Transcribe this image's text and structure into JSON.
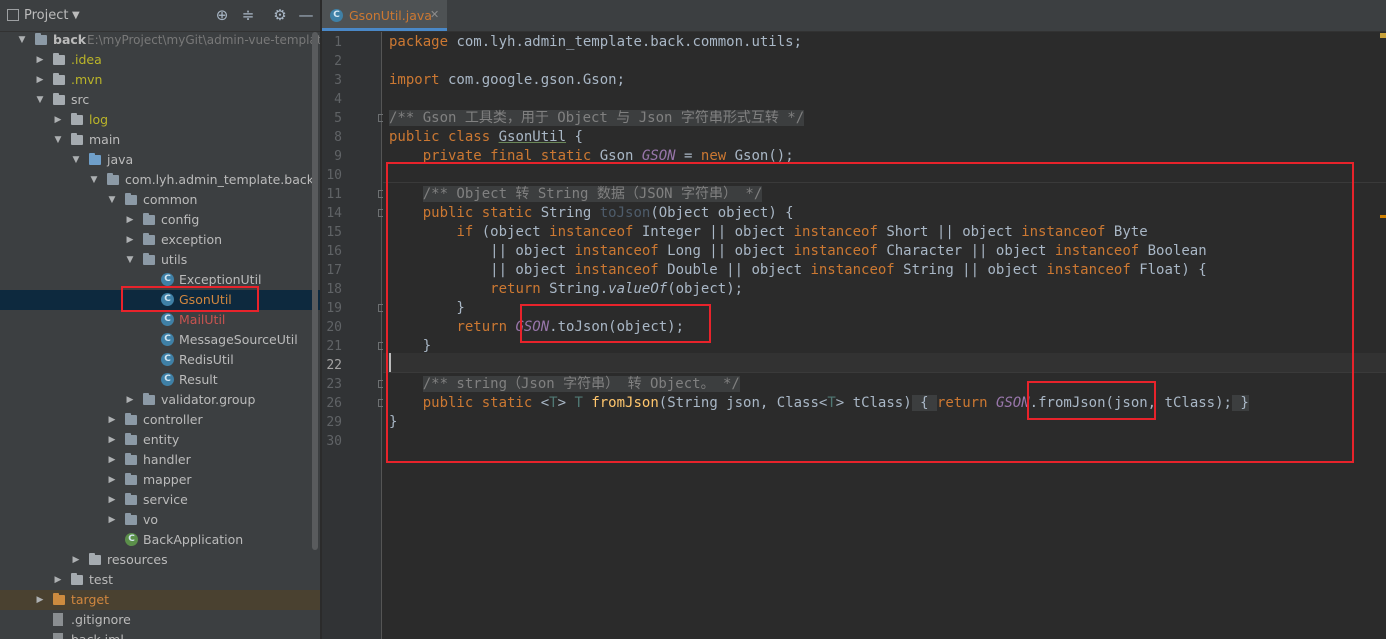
{
  "sidebar": {
    "title": "Project",
    "tree": [
      {
        "label": "back",
        "path": "E:\\myProject\\myGit\\admin-vue-template\\ba",
        "depth": 0,
        "expanded": true,
        "icon": "module-folder-icon",
        "style": "bold"
      },
      {
        "label": ".idea",
        "depth": 1,
        "expanded": false,
        "icon": "folder-icon",
        "style": "yellow"
      },
      {
        "label": ".mvn",
        "depth": 1,
        "expanded": false,
        "icon": "folder-icon",
        "style": "yellow"
      },
      {
        "label": "src",
        "depth": 1,
        "expanded": true,
        "icon": "folder-icon"
      },
      {
        "label": "log",
        "depth": 2,
        "expanded": false,
        "icon": "folder-icon",
        "style": "yellow"
      },
      {
        "label": "main",
        "depth": 2,
        "expanded": true,
        "icon": "folder-icon"
      },
      {
        "label": "java",
        "depth": 3,
        "expanded": true,
        "icon": "source-folder-icon"
      },
      {
        "label": "com.lyh.admin_template.back",
        "depth": 4,
        "expanded": true,
        "icon": "package-icon"
      },
      {
        "label": "common",
        "depth": 5,
        "expanded": true,
        "icon": "package-icon"
      },
      {
        "label": "config",
        "depth": 6,
        "expanded": false,
        "icon": "package-icon"
      },
      {
        "label": "exception",
        "depth": 6,
        "expanded": false,
        "icon": "package-icon"
      },
      {
        "label": "utils",
        "depth": 6,
        "expanded": true,
        "icon": "package-icon"
      },
      {
        "label": "ExceptionUtil",
        "depth": 7,
        "icon": "class-icon"
      },
      {
        "label": "GsonUtil",
        "depth": 7,
        "icon": "class-icon",
        "style": "orange",
        "selected": true
      },
      {
        "label": "MailUtil",
        "depth": 7,
        "icon": "class-icon",
        "style": "red"
      },
      {
        "label": "MessageSourceUtil",
        "depth": 7,
        "icon": "class-icon"
      },
      {
        "label": "RedisUtil",
        "depth": 7,
        "icon": "class-icon"
      },
      {
        "label": "Result",
        "depth": 7,
        "icon": "class-icon"
      },
      {
        "label": "validator.group",
        "depth": 6,
        "expanded": false,
        "icon": "package-icon"
      },
      {
        "label": "controller",
        "depth": 5,
        "expanded": false,
        "icon": "package-icon"
      },
      {
        "label": "entity",
        "depth": 5,
        "expanded": false,
        "icon": "package-icon"
      },
      {
        "label": "handler",
        "depth": 5,
        "expanded": false,
        "icon": "package-icon"
      },
      {
        "label": "mapper",
        "depth": 5,
        "expanded": false,
        "icon": "package-icon"
      },
      {
        "label": "service",
        "depth": 5,
        "expanded": false,
        "icon": "package-icon"
      },
      {
        "label": "vo",
        "depth": 5,
        "expanded": false,
        "icon": "package-icon"
      },
      {
        "label": "BackApplication",
        "depth": 5,
        "icon": "spring-class-icon"
      },
      {
        "label": "resources",
        "depth": 3,
        "expanded": false,
        "icon": "resources-folder-icon"
      },
      {
        "label": "test",
        "depth": 2,
        "expanded": false,
        "icon": "folder-icon"
      },
      {
        "label": "target",
        "depth": 1,
        "expanded": false,
        "icon": "folder-icon",
        "style": "orange",
        "dim": true
      },
      {
        "label": ".gitignore",
        "depth": 1,
        "icon": "file-icon"
      },
      {
        "label": "back.iml",
        "depth": 1,
        "icon": "file-icon"
      }
    ]
  },
  "editor": {
    "tab_label": "GsonUtil.java",
    "lines": [
      {
        "num": "1",
        "html": "<span class='kw'>package</span> com.lyh.admin_template.back.common.utils;"
      },
      {
        "num": "2",
        "html": ""
      },
      {
        "num": "3",
        "html": "<span class='kw'>import</span> com.google.gson.Gson;"
      },
      {
        "num": "4",
        "html": ""
      },
      {
        "num": "5",
        "html": "<span class='cm cmbg'>/** Gson 工具类，用于 Object 与 Json 字符串形式互转 */</span>"
      },
      {
        "num": "8",
        "html": "<span class='kw'>public class</span> <span class='ul'>GsonUtil</span> {"
      },
      {
        "num": "9",
        "html": "    <span class='kw'>private final static</span> Gson <span class='st'>GSON</span> = <span class='kw'>new</span> Gson();"
      },
      {
        "num": "10",
        "html": ""
      },
      {
        "num": "11",
        "html": "    <span class='cm cmbg'>/** Object 转 String 数据（JSON 字符串） */</span>"
      },
      {
        "num": "14",
        "html": "    <span class='kw'>public static</span> String <span class='fd'>toJson</span>(Object object) {"
      },
      {
        "num": "15",
        "html": "        <span class='kw'>if</span> (object <span class='kw'>instanceof</span> Integer || object <span class='kw'>instanceof</span> Short || object <span class='kw'>instanceof</span> Byte"
      },
      {
        "num": "16",
        "html": "            || object <span class='kw'>instanceof</span> Long || object <span class='kw'>instanceof</span> Character || object <span class='kw'>instanceof</span> Boolean"
      },
      {
        "num": "17",
        "html": "            || object <span class='kw'>instanceof</span> Double || object <span class='kw'>instanceof</span> String || object <span class='kw'>instanceof</span> Float) {"
      },
      {
        "num": "18",
        "html": "            <span class='kw'>return</span> String.<span class='it'>valueOf</span>(object);"
      },
      {
        "num": "19",
        "html": "        }"
      },
      {
        "num": "20",
        "html": "        <span class='kw'>return</span> <span class='st'>GSON</span>.toJson(object);"
      },
      {
        "num": "21",
        "html": "    }"
      },
      {
        "num": "22",
        "html": "",
        "current": true
      },
      {
        "num": "23",
        "html": "    <span class='cm cmbg'>/** string（Json 字符串） 转 Object。 */</span>"
      },
      {
        "num": "26",
        "html": "    <span class='kw'>public static</span> &lt;<span class='tp'>T</span>&gt; <span class='tp'>T</span> <span class='fn'>fromJson</span>(String json, Class&lt;<span class='tp'>T</span>&gt; tClass)<span class='cmbg'> { </span><span class='kw'>return</span> <span class='st'>GSON</span>.fromJson(json, tClass);<span class='cmbg'> }</span>"
      },
      {
        "num": "29",
        "html": "}"
      },
      {
        "num": "30",
        "html": ""
      }
    ]
  }
}
